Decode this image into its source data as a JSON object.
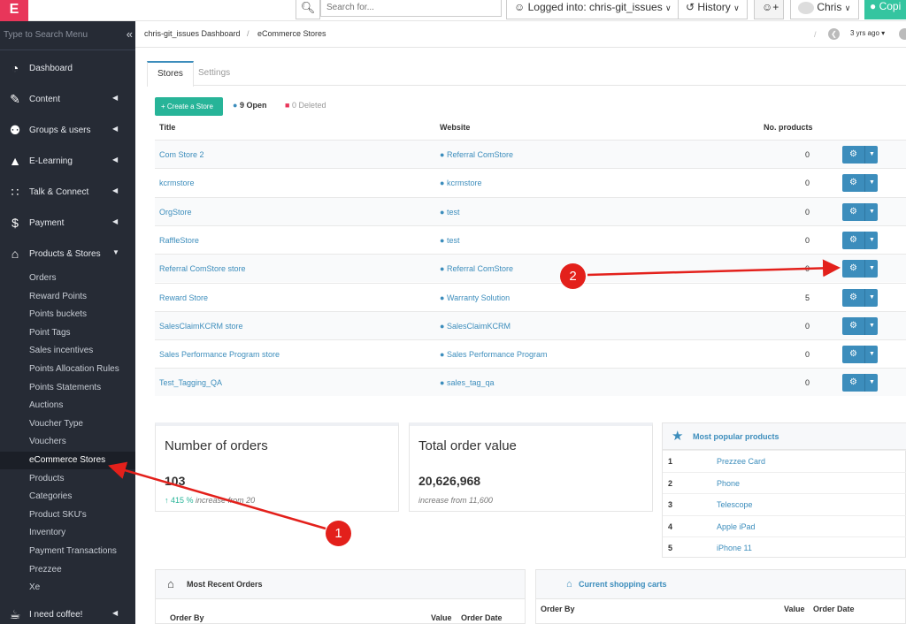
{
  "topbar": {
    "logo": "E",
    "search_placeholder": "Search for...",
    "logged_into": "Logged into: chris-git_issues",
    "history": "History",
    "user_name": "Chris",
    "copilot": "Copi"
  },
  "sidebar": {
    "search_placeholder": "Type to Search Menu",
    "collapse_glyph": "«",
    "items": [
      {
        "label": "Dashboard",
        "icon": "dashboard-icon"
      },
      {
        "label": "Content",
        "icon": "edit-icon"
      },
      {
        "label": "Groups & users",
        "icon": "users-icon"
      },
      {
        "label": "E-Learning",
        "icon": "graduation-cap-icon"
      },
      {
        "label": "Talk & Connect",
        "icon": "rss-icon"
      },
      {
        "label": "Payment",
        "icon": "dollar-icon"
      },
      {
        "label": "Products & Stores",
        "icon": "cart-icon"
      },
      {
        "label": "I need coffee!",
        "icon": "coffee-icon"
      }
    ],
    "sub_items": [
      "Orders",
      "Reward Points",
      "Points buckets",
      "Point Tags",
      "Sales incentives",
      "Points Allocation Rules",
      "Points Statements",
      "Auctions",
      "Voucher Type",
      "Vouchers",
      "eCommerce Stores",
      "Products",
      "Categories",
      "Product SKU's",
      "Inventory",
      "Payment Transactions",
      "Prezzee",
      "Xe"
    ],
    "active_sub": "eCommerce Stores"
  },
  "breadcrumb": {
    "dashboard": "chris-git_issues Dashboard",
    "separator": "/",
    "current": "eCommerce Stores",
    "divider": "/",
    "time_ago": "3 yrs ago ▾"
  },
  "tabs": {
    "stores": "Stores",
    "settings": "Settings"
  },
  "actions": {
    "create": "+ Create a Store",
    "open": "9 Open",
    "deleted": "0 Deleted"
  },
  "table": {
    "headers": {
      "title": "Title",
      "website": "Website",
      "products": "No. products"
    },
    "rows": [
      {
        "title": "Com Store 2",
        "website": "Referral ComStore",
        "products": "0"
      },
      {
        "title": "kcrmstore",
        "website": "kcrmstore",
        "products": "0"
      },
      {
        "title": "OrgStore",
        "website": "test",
        "products": "0"
      },
      {
        "title": "RaffleStore",
        "website": "test",
        "products": "0"
      },
      {
        "title": "Referral ComStore store",
        "website": "Referral ComStore",
        "products": "0"
      },
      {
        "title": "Reward Store",
        "website": "Warranty Solution",
        "products": "5"
      },
      {
        "title": "SalesClaimKCRM store",
        "website": "SalesClaimKCRM",
        "products": "0"
      },
      {
        "title": "Sales Performance Program store",
        "website": "Sales Performance Program",
        "products": "0"
      },
      {
        "title": "Test_Tagging_QA",
        "website": "sales_tag_qa",
        "products": "0"
      }
    ]
  },
  "stats": {
    "orders": {
      "title": "Number of orders",
      "value": "103",
      "pct": "415 %",
      "sub": " increase from 20"
    },
    "value": {
      "title": "Total order value",
      "value": "20,626,968",
      "sub": "increase from 11,600"
    }
  },
  "popular": {
    "title": "Most popular products",
    "items": [
      {
        "rank": "1",
        "name": "Prezzee Card"
      },
      {
        "rank": "2",
        "name": "Phone"
      },
      {
        "rank": "3",
        "name": "Telescope"
      },
      {
        "rank": "4",
        "name": "Apple iPad"
      },
      {
        "rank": "5",
        "name": "iPhone 11"
      }
    ]
  },
  "recent_orders": {
    "title": "Most Recent Orders",
    "cols": {
      "order_by": "Order By",
      "value": "Value",
      "date": "Order Date"
    }
  },
  "carts": {
    "title": "Current shopping carts",
    "cols": {
      "order_by": "Order By",
      "value": "Value",
      "date": "Order Date"
    }
  },
  "annotations": {
    "marker1": "1",
    "marker2": "2",
    "color": "#e3201b"
  }
}
